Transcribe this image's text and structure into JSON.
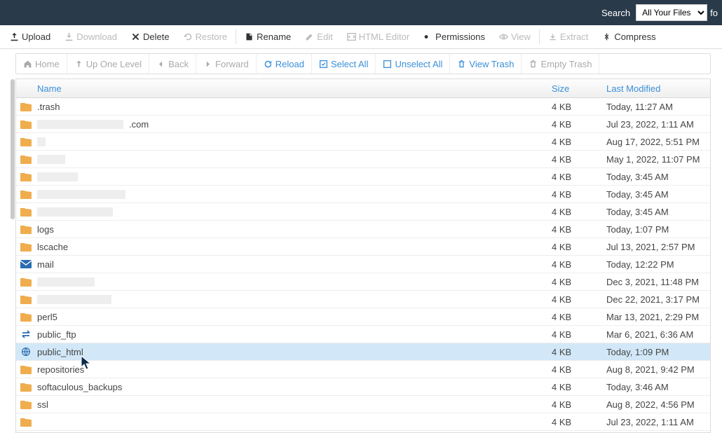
{
  "topbar": {
    "search_label": "Search",
    "search_selected": "All Your Files",
    "after_text": "fo"
  },
  "toolbar": {
    "upload": "Upload",
    "download": "Download",
    "delete": "Delete",
    "restore": "Restore",
    "rename": "Rename",
    "edit": "Edit",
    "html_editor": "HTML Editor",
    "permissions": "Permissions",
    "view": "View",
    "extract": "Extract",
    "compress": "Compress"
  },
  "nav": {
    "home": "Home",
    "up": "Up One Level",
    "back": "Back",
    "forward": "Forward",
    "reload": "Reload",
    "select_all": "Select All",
    "unselect_all": "Unselect All",
    "view_trash": "View Trash",
    "empty_trash": "Empty Trash"
  },
  "headers": {
    "name": "Name",
    "size": "Size",
    "modified": "Last Modified"
  },
  "rows": [
    {
      "icon": "folder",
      "name": ".trash",
      "redacted": 0,
      "size": "4 KB",
      "date": "Today, 11:27 AM"
    },
    {
      "icon": "folder",
      "name": ".com",
      "redacted": 123,
      "size": "4 KB",
      "date": "Jul 23, 2022, 1:11 AM"
    },
    {
      "icon": "folder",
      "name": "",
      "redacted": 12,
      "size": "4 KB",
      "date": "Aug 17, 2022, 5:51 PM"
    },
    {
      "icon": "folder",
      "name": "",
      "redacted": 40,
      "size": "4 KB",
      "date": "May 1, 2022, 11:07 PM"
    },
    {
      "icon": "folder",
      "name": "",
      "redacted": 58,
      "size": "4 KB",
      "date": "Today, 3:45 AM"
    },
    {
      "icon": "folder",
      "name": "",
      "redacted": 126,
      "size": "4 KB",
      "date": "Today, 3:45 AM"
    },
    {
      "icon": "folder",
      "name": "",
      "redacted": 108,
      "size": "4 KB",
      "date": "Today, 3:45 AM"
    },
    {
      "icon": "folder",
      "name": "logs",
      "redacted": 0,
      "size": "4 KB",
      "date": "Today, 1:07 PM"
    },
    {
      "icon": "folder",
      "name": "lscache",
      "redacted": 0,
      "size": "4 KB",
      "date": "Jul 13, 2021, 2:57 PM"
    },
    {
      "icon": "mail",
      "name": "mail",
      "redacted": 0,
      "size": "4 KB",
      "date": "Today, 12:22 PM"
    },
    {
      "icon": "folder",
      "name": "",
      "redacted": 82,
      "size": "4 KB",
      "date": "Dec 3, 2021, 11:48 PM"
    },
    {
      "icon": "folder",
      "name": "",
      "redacted": 106,
      "size": "4 KB",
      "date": "Dec 22, 2021, 3:17 PM"
    },
    {
      "icon": "folder",
      "name": "perl5",
      "redacted": 0,
      "size": "4 KB",
      "date": "Mar 13, 2021, 2:29 PM"
    },
    {
      "icon": "ftp",
      "name": "public_ftp",
      "redacted": 0,
      "size": "4 KB",
      "date": "Mar 6, 2021, 6:36 AM"
    },
    {
      "icon": "globe",
      "name": "public_html",
      "redacted": 0,
      "size": "4 KB",
      "date": "Today, 1:09 PM",
      "selected": true
    },
    {
      "icon": "folder",
      "name": "repositories",
      "redacted": 0,
      "size": "4 KB",
      "date": "Aug 8, 2021, 9:42 PM"
    },
    {
      "icon": "folder",
      "name": "softaculous_backups",
      "redacted": 0,
      "size": "4 KB",
      "date": "Today, 3:46 AM"
    },
    {
      "icon": "folder",
      "name": "ssl",
      "redacted": 0,
      "size": "4 KB",
      "date": "Aug 8, 2022, 4:56 PM"
    },
    {
      "icon": "folder",
      "name": "",
      "redacted": 0,
      "size": "4 KB",
      "date": "Jul 23, 2022, 1:11 AM"
    }
  ]
}
